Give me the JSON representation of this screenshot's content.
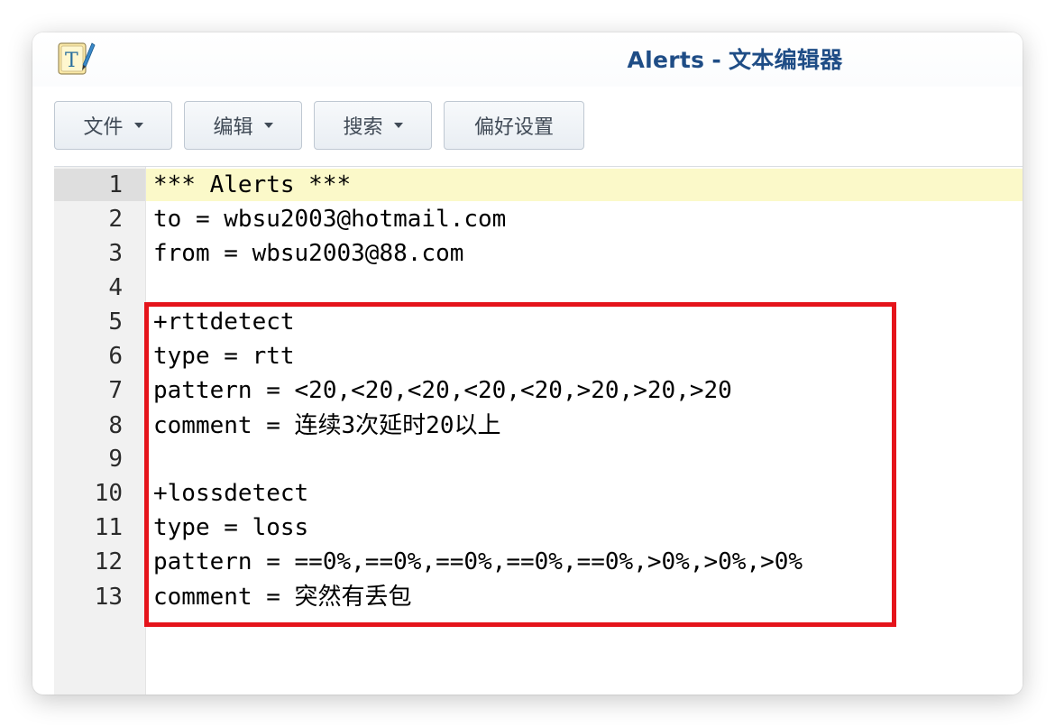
{
  "window": {
    "title_name": "Alerts",
    "title_separator": "-",
    "title_app": "文本编辑器",
    "app_icon": "text-editor-icon",
    "title_color": "#1f4d86"
  },
  "toolbar": {
    "file_label": "文件",
    "edit_label": "编辑",
    "search_label": "搜索",
    "prefs_label": "偏好设置"
  },
  "editor": {
    "active_line": 1,
    "active_line_color": "#fbf9c9",
    "lines": [
      {
        "num": "1",
        "text": "*** Alerts ***"
      },
      {
        "num": "2",
        "text": "to = wbsu2003@hotmail.com"
      },
      {
        "num": "3",
        "text": "from = wbsu2003@88.com"
      },
      {
        "num": "4",
        "text": ""
      },
      {
        "num": "5",
        "text": "+rttdetect"
      },
      {
        "num": "6",
        "text": "type = rtt"
      },
      {
        "num": "7",
        "text": "pattern = <20,<20,<20,<20,<20,>20,>20,>20"
      },
      {
        "num": "8",
        "text": "comment = 连续3次延时20以上"
      },
      {
        "num": "9",
        "text": ""
      },
      {
        "num": "10",
        "text": "+lossdetect"
      },
      {
        "num": "11",
        "text": "type = loss"
      },
      {
        "num": "12",
        "text": "pattern = ==0%,==0%,==0%,==0%,==0%,>0%,>0%,>0%"
      },
      {
        "num": "13",
        "text": "comment = 突然有丢包"
      }
    ]
  },
  "annotation": {
    "box_color": "#e5141b"
  }
}
